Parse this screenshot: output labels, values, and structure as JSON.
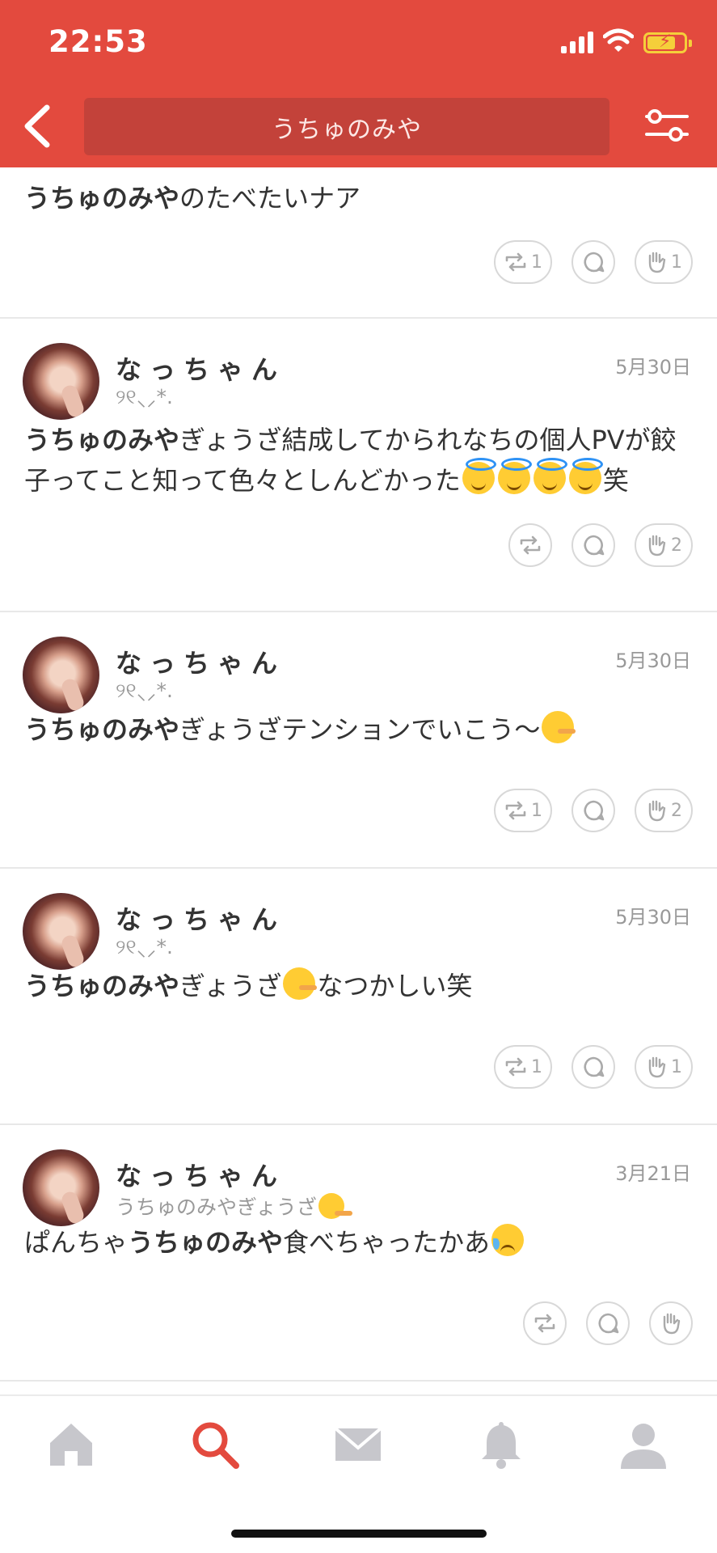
{
  "status_bar": {
    "time": "22:53"
  },
  "header": {
    "search_text": "うちゅのみや"
  },
  "colors": {
    "accent": "#e34a3e",
    "search_bg": "#c3423a",
    "tab_inactive": "#c7c7cc"
  },
  "posts": [
    {
      "body_bold": "うちゅのみや",
      "body_rest": "のたべたいナア",
      "repost_count": "1",
      "reply_count": "",
      "clap_count": "1"
    },
    {
      "username": "なっちゃん",
      "subline": "୨୧‪⸜‪⸝‬*.",
      "date": "5月30日",
      "body_bold": "うちゅのみや",
      "body_rest": "ぎょうざ結成してかられなちの個人PVが餃子ってこと知って色々としんどかった",
      "body_after": "笑",
      "emoji": [
        "smiling-face-with-halo",
        "smiling-face-with-halo",
        "smiling-face-with-halo",
        "smiling-face-with-halo"
      ],
      "repost_count": "",
      "reply_count": "",
      "clap_count": "2"
    },
    {
      "username": "なっちゃん",
      "subline": "୨୧‪⸜‪⸝‬*.",
      "date": "5月30日",
      "body_bold": "うちゅのみや",
      "body_rest": "ぎょうざテンションでいこう〜",
      "emoji": [
        "lying-face"
      ],
      "repost_count": "1",
      "reply_count": "",
      "clap_count": "2"
    },
    {
      "username": "なっちゃん",
      "subline": "୨୧‪⸜‪⸝‬*.",
      "date": "5月30日",
      "body_bold": "うちゅのみや",
      "body_rest": "ぎょうざ",
      "emoji": [
        "lying-face"
      ],
      "body_after": "なつかしい笑",
      "repost_count": "1",
      "reply_count": "",
      "clap_count": "1"
    },
    {
      "username": "なっちゃん",
      "subline": "うちゅのみやぎょうざ",
      "subline_emoji": "lying-face",
      "date": "3月21日",
      "body_before": "ぱんちゃ",
      "body_bold": "うちゅのみや",
      "body_rest": "食べちゃったかあ",
      "emoji": [
        "sad-but-relieved-face"
      ],
      "repost_count": "",
      "reply_count": "",
      "clap_count": ""
    }
  ],
  "tabbar": {
    "items": [
      {
        "icon": "home-icon",
        "active": false
      },
      {
        "icon": "search-icon",
        "active": true
      },
      {
        "icon": "mail-icon",
        "active": false
      },
      {
        "icon": "bell-icon",
        "active": false
      },
      {
        "icon": "profile-icon",
        "active": false
      }
    ]
  }
}
